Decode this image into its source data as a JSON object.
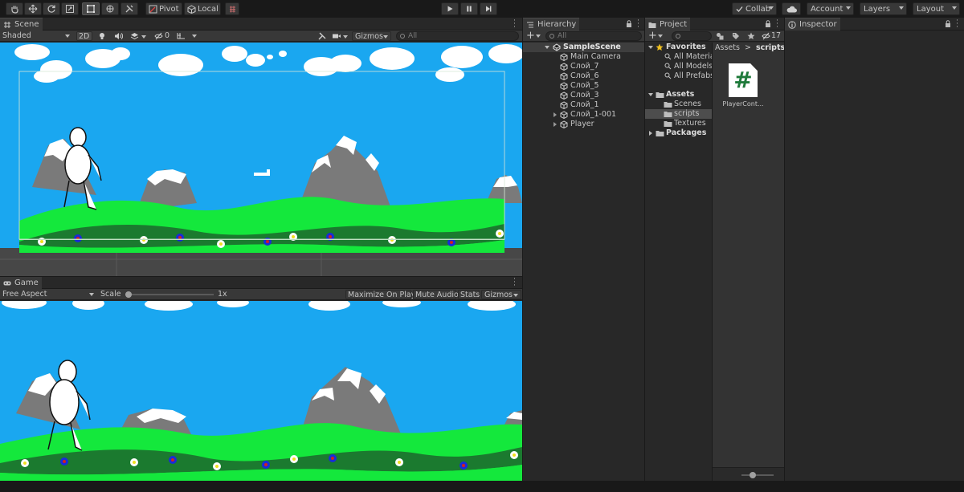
{
  "toolbar": {
    "pivot_label": "Pivot",
    "local_label": "Local",
    "collab_label": "Collab",
    "account_label": "Account",
    "layers_label": "Layers",
    "layout_label": "Layout"
  },
  "scene": {
    "tab_label": "Scene",
    "shading_mode": "Shaded",
    "toggle_2d": "2D",
    "hidden_count": "0",
    "gizmos_label": "Gizmos",
    "search_placeholder": "All"
  },
  "game": {
    "tab_label": "Game",
    "aspect": "Free Aspect",
    "scale_label": "Scale",
    "scale_value": "1x",
    "scale_fraction": 0.0,
    "maximize_label": "Maximize On Play",
    "mute_label": "Mute Audio",
    "stats_label": "Stats",
    "gizmos_label": "Gizmos"
  },
  "hierarchy": {
    "tab_label": "Hierarchy",
    "search_placeholder": "All",
    "scene_name": "SampleScene",
    "items": [
      {
        "label": "Main Camera",
        "expandable": false
      },
      {
        "label": "Слой_7",
        "expandable": false
      },
      {
        "label": "Слой_6",
        "expandable": false
      },
      {
        "label": "Слой_5",
        "expandable": false
      },
      {
        "label": "Слой_3",
        "expandable": false
      },
      {
        "label": "Слой_1",
        "expandable": false
      },
      {
        "label": "Слой_1-001",
        "expandable": true
      },
      {
        "label": "Player",
        "expandable": true
      }
    ]
  },
  "project": {
    "tab_label": "Project",
    "hidden_count": "17",
    "favorites": {
      "label": "Favorites",
      "items": [
        "All Materia",
        "All Models",
        "All Prefabs"
      ]
    },
    "assets": {
      "label": "Assets",
      "items": [
        "Scenes",
        "scripts",
        "Textures"
      ],
      "selected": "scripts"
    },
    "packages_label": "Packages",
    "breadcrumb": {
      "root": "Assets",
      "separator": ">",
      "current": "scripts"
    },
    "files": [
      {
        "name": "PlayerCont...",
        "icon": "#"
      }
    ],
    "icon_size_fraction": 0.3
  },
  "inspector": {
    "tab_label": "Inspector"
  },
  "colors": {
    "sky": "#1aa7f0",
    "grass": "#14e83c",
    "dark_grass": "#1b7a2f",
    "mountain": "#7d7d7d",
    "editor_bg": "#282828",
    "selection": "#4d4d4d"
  }
}
